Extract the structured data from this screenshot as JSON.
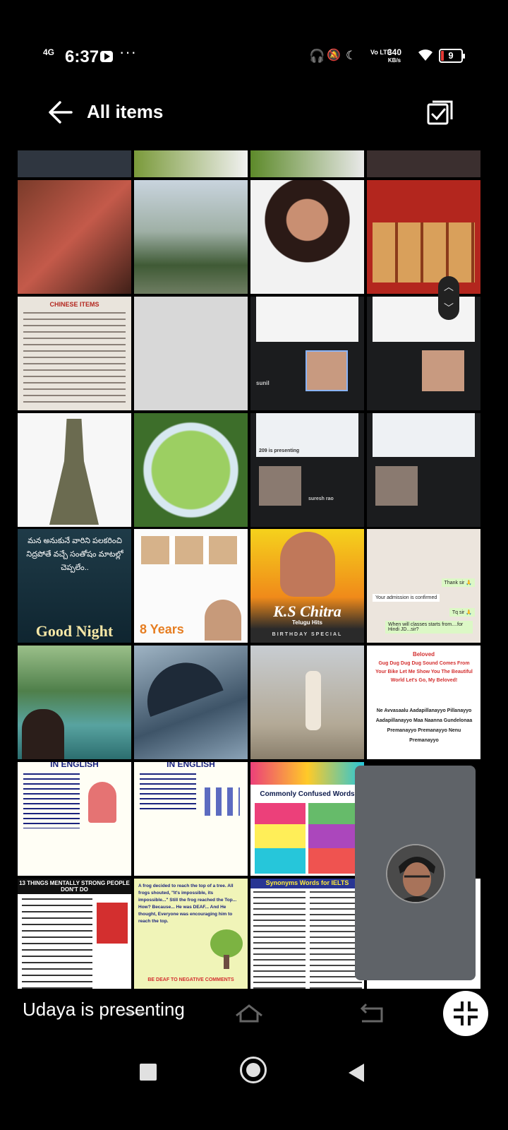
{
  "status_bar": {
    "network": "4G",
    "time": "6:37",
    "more": "···",
    "volte": "Vo LTE",
    "speed_value": "340",
    "speed_unit": "KB/s",
    "battery": "9"
  },
  "app_bar": {
    "title": "All items"
  },
  "thumbnails": {
    "menu_title": "CHINESE ITEMS",
    "meet_presenting": "209 is presenting",
    "meet_name_1": "sunil",
    "meet_name_2": "suresh rao",
    "telugu_text": "మన అనుకునే వారిని పలకరించి నిద్రపోతే వచ్చే సంతోషం మాటల్లో చెప్పలేం..",
    "good_night": "Good Night",
    "years": "8 Years",
    "chitra_name": "K.S Chitra",
    "chitra_sub": "Telugu Hits",
    "chitra_banner": "BIRTHDAY SPECIAL",
    "chat_1": "Thank sir 🙏",
    "chat_2": "Your admission is confirmed",
    "chat_3": "Tq sir 🙏",
    "chat_4": "When will classes starts from....for Hindi JD...sir?",
    "song_title": "Beloved",
    "song_lines": "Gug Dug Dug Dug Sound Comes From Your Bike Let Me Show You The Beautiful World Let's Go, My Beloved!",
    "song_lyrics": "Ne Avvasaalu Aadapillanayyo Pillanayyo Aadapillanayyo Maa Naanna Gundelonaa Premanayyo Premanayyo Nenu Premanayyo",
    "english_header": "IN ENGLISH",
    "confused_words": "Commonly Confused Words",
    "mentally_strong": "13 THINGS MENTALLY STRONG PEOPLE DON'T DO",
    "frog_story": "A frog decided to reach the top of a tree. All frogs shouted, \"It's impossible, its impossible...\" Still the frog reached the Top... How? Because... He was DEAF... And He thought, Everyone was encouraging him to reach the top.",
    "frog_footer": "BE DEAF TO NEGATIVE COMMENTS",
    "ielts_title": "Synonyms Words for IELTS"
  },
  "presenting_bar": {
    "text": "Udaya is presenting"
  },
  "icons": {
    "back": "arrow-left-icon",
    "select": "multi-select-icon",
    "fullscreen": "exit-fullscreen-icon",
    "scroll_up": "chevron-up-icon",
    "scroll_down": "chevron-down-icon"
  }
}
